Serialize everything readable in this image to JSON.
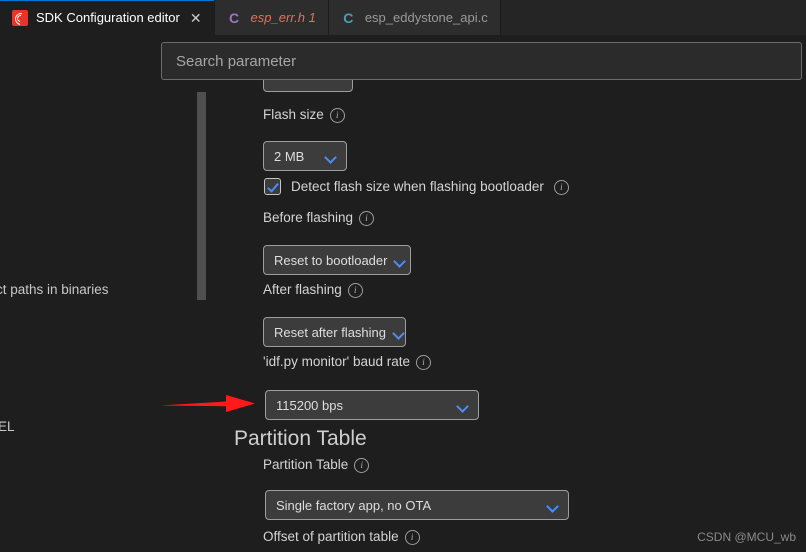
{
  "window": {
    "background_color": "#1e1e1e",
    "accent_color": "#4e8bf5",
    "annotation_color": "#ff1a1a"
  },
  "tabs": [
    {
      "label": "SDK Configuration editor",
      "icon": "esp-idf-logo-icon",
      "active": true,
      "close_glyph": "✕"
    },
    {
      "label": "esp_err.h 1",
      "icon": "c-file-icon",
      "icon_glyph": "C",
      "active": false,
      "modified": true
    },
    {
      "label": "esp_eddystone_api.c",
      "icon": "c-file-icon",
      "icon_glyph": "C",
      "active": false,
      "modified": false
    }
  ],
  "search": {
    "placeholder": "Search parameter",
    "value": ""
  },
  "background_panel": {
    "clipped_text_1": "ct paths in binaries",
    "clipped_text_2": "EL"
  },
  "settings": {
    "flash_size": {
      "label": "Flash size",
      "info_glyph": "i",
      "value": "2 MB"
    },
    "detect_flash_size": {
      "label": "Detect flash size when flashing bootloader",
      "info_glyph": "i",
      "checked": true
    },
    "before_flashing": {
      "label": "Before flashing",
      "info_glyph": "i",
      "value": "Reset to bootloader"
    },
    "after_flashing": {
      "label": "After flashing",
      "info_glyph": "i",
      "value": "Reset after flashing"
    },
    "monitor_baud_rate": {
      "label": "'idf.py monitor' baud rate",
      "info_glyph": "i",
      "value": "115200 bps"
    }
  },
  "partition_section": {
    "heading": "Partition Table",
    "partition_table": {
      "label": "Partition Table",
      "info_glyph": "i",
      "value": "Single factory app, no OTA"
    },
    "offset": {
      "label": "Offset of partition table",
      "info_glyph": "i"
    }
  },
  "watermark": "CSDN @MCU_wb"
}
